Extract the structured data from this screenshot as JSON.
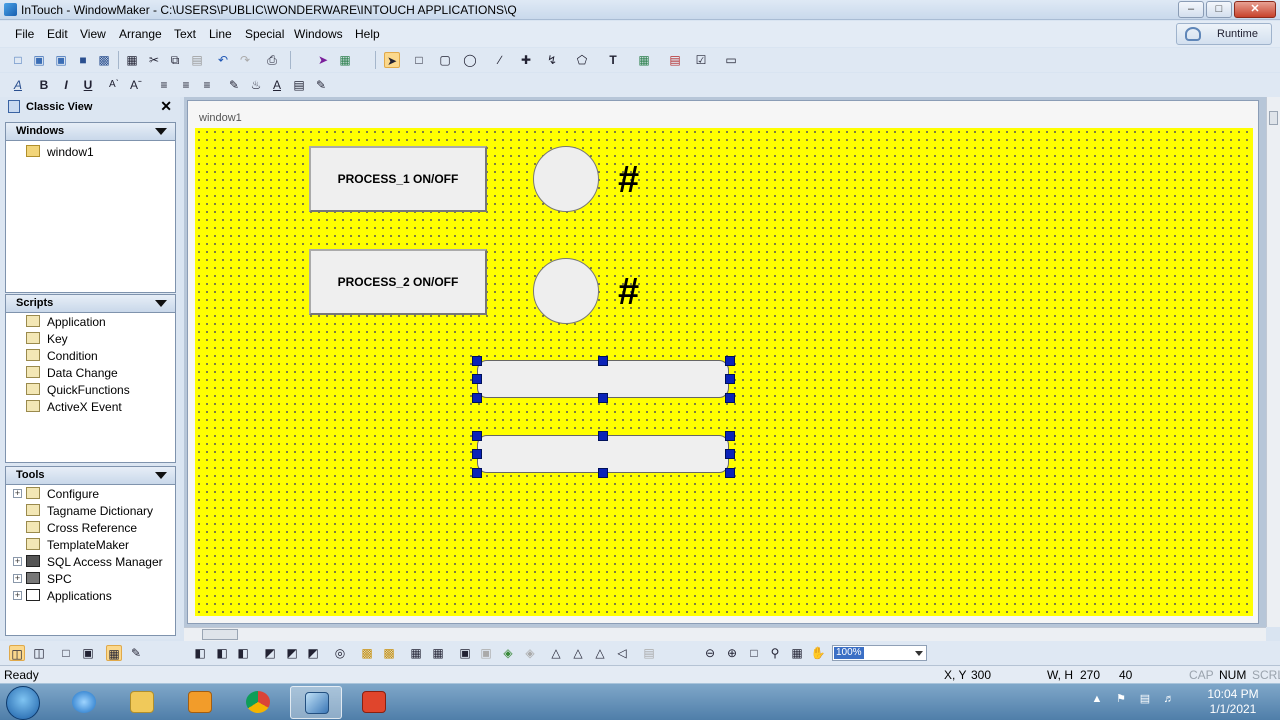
{
  "window": {
    "title": "InTouch - WindowMaker - C:\\USERS\\PUBLIC\\WONDERWARE\\INTOUCH APPLICATIONS\\Q",
    "controls": [
      "minimize-icon",
      "maximize-icon",
      "close-icon"
    ]
  },
  "menu": {
    "items": [
      "File",
      "Edit",
      "View",
      "Arrange",
      "Text",
      "Line",
      "Special",
      "Windows",
      "Help"
    ],
    "runtime_label": "Runtime"
  },
  "left_panel": {
    "title": "Classic View",
    "windows": {
      "header": "Windows",
      "items": [
        "window1"
      ]
    },
    "scripts": {
      "header": "Scripts",
      "items": [
        "Application",
        "Key",
        "Condition",
        "Data Change",
        "QuickFunctions",
        "ActiveX Event"
      ]
    },
    "tools": {
      "header": "Tools",
      "items": [
        "Configure",
        "Tagname Dictionary",
        "Cross Reference",
        "TemplateMaker",
        "SQL Access Manager",
        "SPC",
        "Applications"
      ]
    }
  },
  "canvas": {
    "window_name": "window1",
    "background_color": "#ffff00",
    "buttons": [
      "PROCESS_1 ON/OFF",
      "PROCESS_2 ON/OFF"
    ],
    "value_placeholders": [
      "#",
      "#"
    ],
    "selection_handle_color": "#0b23b8"
  },
  "toolbar_bottom": {
    "zoom": "100%"
  },
  "status": {
    "ready": "Ready",
    "xy_label": "X, Y",
    "xy_value": "300",
    "wh_label": "W, H",
    "w_value": "270",
    "h_value": "40",
    "cap": "CAP",
    "num": "NUM",
    "scrl": "SCRL"
  },
  "taskbar": {
    "time": "10:04 PM",
    "date": "1/1/2021"
  }
}
